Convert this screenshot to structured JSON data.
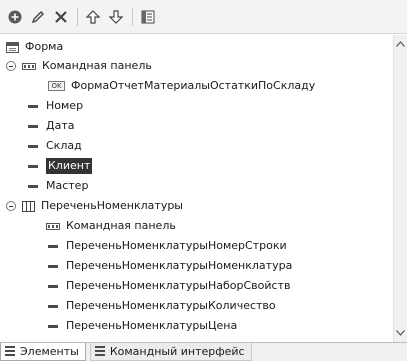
{
  "toolbar": {
    "buttons": [
      "add-icon",
      "edit-icon",
      "delete-icon",
      "move-up-icon",
      "move-down-icon",
      "properties-icon"
    ]
  },
  "tree": {
    "items": [
      {
        "label": "Форма",
        "icon": "form-icon",
        "expandable": false
      },
      {
        "label": "Командная панель",
        "icon": "command-panel-icon",
        "expandable": true
      },
      {
        "label": "ФормаОтчетМатериалыОстаткиПоСкладу",
        "icon": "ok-button-icon",
        "expandable": false
      },
      {
        "label": "Номер",
        "icon": "field-icon",
        "expandable": false
      },
      {
        "label": "Дата",
        "icon": "field-icon",
        "expandable": false
      },
      {
        "label": "Склад",
        "icon": "field-icon",
        "expandable": false
      },
      {
        "label": "Клиент",
        "icon": "field-icon",
        "expandable": false,
        "selected": true
      },
      {
        "label": "Мастер",
        "icon": "field-icon",
        "expandable": false
      },
      {
        "label": "ПереченьНоменклатуры",
        "icon": "table-icon",
        "expandable": true
      },
      {
        "label": "Командная панель",
        "icon": "command-panel-icon",
        "expandable": false
      },
      {
        "label": "ПереченьНоменклатурыНомерСтроки",
        "icon": "field-icon",
        "expandable": false
      },
      {
        "label": "ПереченьНоменклатурыНоменклатура",
        "icon": "field-icon",
        "expandable": false
      },
      {
        "label": "ПереченьНоменклатурыНаборСвойств",
        "icon": "field-icon",
        "expandable": false
      },
      {
        "label": "ПереченьНоменклатурыКоличество",
        "icon": "field-icon",
        "expandable": false
      },
      {
        "label": "ПереченьНоменклатурыЦена",
        "icon": "field-icon",
        "expandable": false
      }
    ]
  },
  "tabs": [
    {
      "label": "Элементы",
      "active": true
    },
    {
      "label": "Командный интерфейс",
      "active": false
    }
  ],
  "colors": {
    "selection": "#333333",
    "toolbar_bg": "#f3f3f3"
  }
}
